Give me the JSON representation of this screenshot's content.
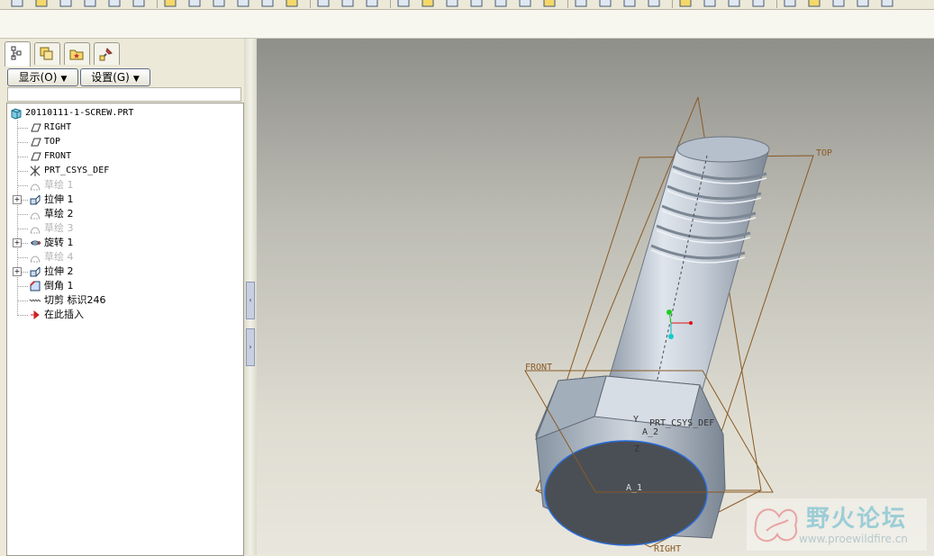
{
  "toolbar": {
    "buttons": [
      "new-icon",
      "open-icon",
      "save-icon",
      "print-icon",
      "email-icon",
      "settings-icon",
      "undo-icon",
      "redo-icon",
      "cut-icon",
      "copy-icon",
      "paste-icon",
      "paste-special-icon",
      "regenerate-icon",
      "regen-manager-icon",
      "window-icon",
      "find-icon",
      "display-style-icon",
      "datum-planes-icon",
      "datum-axes-icon",
      "datum-points-icon",
      "csys-icon",
      "spin-center-icon",
      "annotations-icon",
      "refit-icon",
      "zoom-in-icon",
      "zoom-out-icon",
      "orient-icon",
      "saved-views-icon",
      "layers-icon",
      "appearance-icon",
      "model-display-icon",
      "wireframe-icon",
      "hidden-line-icon",
      "no-hidden-icon",
      "shading-icon"
    ]
  },
  "nav": {
    "tabs": [
      "model-tree-tab",
      "folder-browser-tab",
      "favorites-tab",
      "connections-tab"
    ],
    "show_button": "显示(O)",
    "settings_button": "设置(G)"
  },
  "tree": {
    "root": "20110111-1-SCREW.PRT",
    "items": [
      {
        "label": "RIGHT",
        "icon": "datum-plane-icon",
        "dim": false,
        "expandable": false
      },
      {
        "label": "TOP",
        "icon": "datum-plane-icon",
        "dim": false,
        "expandable": false
      },
      {
        "label": "FRONT",
        "icon": "datum-plane-icon",
        "dim": false,
        "expandable": false
      },
      {
        "label": "PRT_CSYS_DEF",
        "icon": "csys-icon",
        "dim": false,
        "expandable": false
      },
      {
        "label": "草绘 1",
        "icon": "sketch-icon",
        "dim": true,
        "expandable": false
      },
      {
        "label": "拉伸 1",
        "icon": "extrude-icon",
        "dim": false,
        "expandable": true
      },
      {
        "label": "草绘 2",
        "icon": "sketch-icon",
        "dim": false,
        "expandable": false
      },
      {
        "label": "草绘 3",
        "icon": "sketch-icon",
        "dim": true,
        "expandable": false
      },
      {
        "label": "旋转 1",
        "icon": "revolve-icon",
        "dim": false,
        "expandable": true
      },
      {
        "label": "草绘 4",
        "icon": "sketch-icon",
        "dim": true,
        "expandable": false
      },
      {
        "label": "拉伸 2",
        "icon": "extrude-icon",
        "dim": false,
        "expandable": true
      },
      {
        "label": "倒角 1",
        "icon": "chamfer-icon",
        "dim": false,
        "expandable": false
      },
      {
        "label": "切剪 标识246",
        "icon": "cosmetic-thread-icon",
        "dim": false,
        "expandable": false
      },
      {
        "label": "在此插入",
        "icon": "insert-here-icon",
        "dim": false,
        "expandable": false
      }
    ]
  },
  "viewport": {
    "datum_labels": {
      "top": "TOP",
      "front": "FRONT",
      "right": "RIGHT",
      "csys": "PRT_CSYS_DEF",
      "axis1": "A_1",
      "axis2": "A_2",
      "csys_x": "Y",
      "csys_z": "Z"
    }
  },
  "watermark": {
    "title": "野火论坛",
    "url": "www.proewildfire.cn"
  },
  "colors": {
    "datum": "#8a5a24",
    "model": "#a9b4c0",
    "edge": "#2a6cd8",
    "panel": "#ece9d8"
  }
}
